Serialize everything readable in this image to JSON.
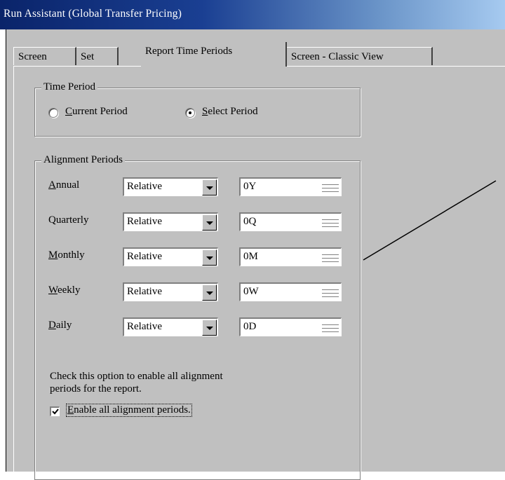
{
  "window": {
    "title": "Run Assistant   (Global Transfer Pricing)"
  },
  "tabs": [
    {
      "label": "Screen"
    },
    {
      "label": "Set"
    },
    {
      "label": "Report Time Periods",
      "active": true
    },
    {
      "label": "Screen - Classic View"
    }
  ],
  "time_period": {
    "legend": "Time Period",
    "options": [
      {
        "label_key": "C",
        "label_rest": "urrent Period",
        "selected": false
      },
      {
        "label_key": "S",
        "label_rest": "elect Period",
        "selected": true
      }
    ]
  },
  "alignment": {
    "legend": "Alignment Periods",
    "rows": [
      {
        "key": "A",
        "rest": "nnual",
        "mode": "Relative",
        "value": "0Y"
      },
      {
        "key": "",
        "rest": "Quarterly",
        "mode": "Relative",
        "value": "0Q"
      },
      {
        "key": "M",
        "rest": "onthly",
        "mode": "Relative",
        "value": "0M"
      },
      {
        "key": "W",
        "rest": "eekly",
        "mode": "Relative",
        "value": "0W"
      },
      {
        "key": "D",
        "rest": "aily",
        "mode": "Relative",
        "value": "0D"
      }
    ],
    "hint_line1": "Check this option to enable all alignment",
    "hint_line2": "periods for the report.",
    "enable_all": {
      "key": "E",
      "rest": "nable all alignment periods.",
      "checked": true
    }
  }
}
